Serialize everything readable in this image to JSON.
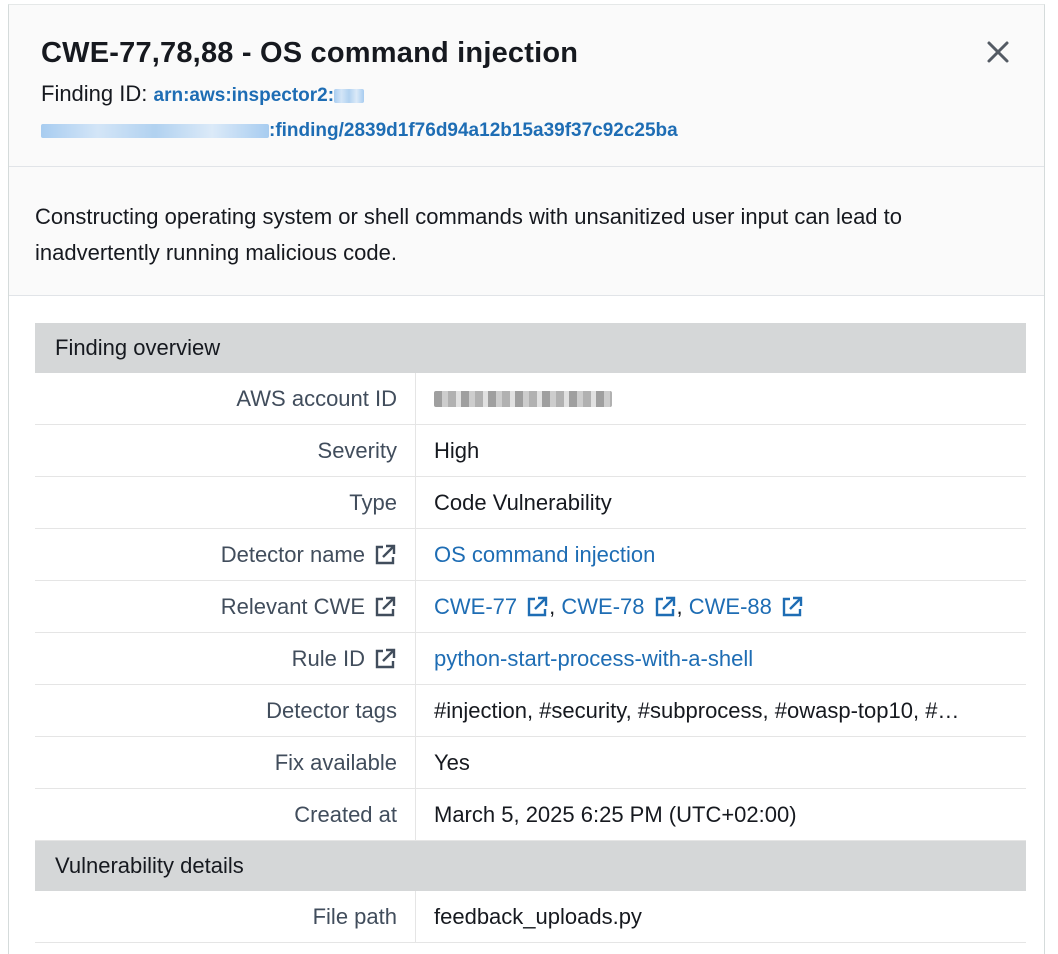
{
  "header": {
    "title": "CWE-77,78,88 - OS command injection",
    "finding_id_label": "Finding ID:",
    "arn_prefix": "arn:aws:inspector2:",
    "arn_suffix": ":finding/2839d1f76d94a12b15a39f37c92c25ba",
    "close_icon": "close-icon"
  },
  "description": "Constructing operating system or shell commands with unsanitized user input can lead to inadvertently running malicious code.",
  "sections": {
    "overview_title": "Finding overview",
    "vuln_title": "Vulnerability details"
  },
  "overview": {
    "account_label": "AWS account ID",
    "severity_label": "Severity",
    "severity_value": "High",
    "type_label": "Type",
    "type_value": "Code Vulnerability",
    "detector_label": "Detector name",
    "detector_value": "OS command injection",
    "cwe_label": "Relevant CWE",
    "cwe_values": [
      "CWE-77",
      "CWE-78",
      "CWE-88"
    ],
    "cwe_separator": ",",
    "rule_label": "Rule ID",
    "rule_value": "python-start-process-with-a-shell",
    "tags_label": "Detector tags",
    "tags_value": "#injection, #security, #subprocess, #owasp-top10, #…",
    "fix_label": "Fix available",
    "fix_value": "Yes",
    "created_label": "Created at",
    "created_value": "March 5, 2025 6:25 PM (UTC+02:00)"
  },
  "vulnerability": {
    "file_label": "File path",
    "file_value": "feedback_uploads.py"
  },
  "colors": {
    "link": "#1e6db4",
    "section_bg": "#d5d7d8",
    "header_bg": "#fafafa"
  }
}
